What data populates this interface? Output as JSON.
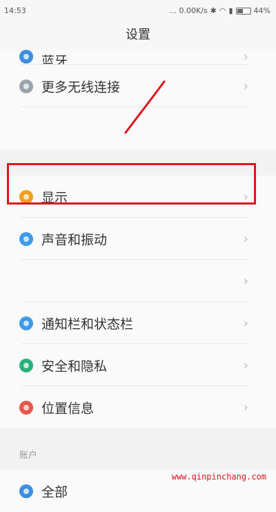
{
  "status_bar": {
    "time": "14:53",
    "network_speed": "... 0.00K/s",
    "battery": "44%"
  },
  "header": {
    "title": "设置"
  },
  "settings": {
    "items": [
      {
        "label": "蓝牙",
        "icon": "bluetooth-icon",
        "color": "#3d8fe0"
      },
      {
        "label": "更多无线连接",
        "icon": "more-wireless-icon",
        "color": "#9aa4ad"
      },
      {
        "label": "显示",
        "icon": "display-icon",
        "color": "#f0a020"
      },
      {
        "label": "声音和振动",
        "icon": "sound-icon",
        "color": "#3d9be9"
      },
      {
        "label": "通知栏和状态栏",
        "icon": "notification-icon",
        "color": "#3d9be9"
      },
      {
        "label": "安全和隐私",
        "icon": "security-icon",
        "color": "#27b07a"
      },
      {
        "label": "位置信息",
        "icon": "location-icon",
        "color": "#e8584a"
      },
      {
        "label": "全部",
        "icon": "all-icon",
        "color": "#3d8fe0"
      }
    ],
    "section_account": "账户",
    "chevron": "›"
  },
  "watermark": "www.qinpinchang.com",
  "colors": {
    "highlight": "#e0141c"
  }
}
